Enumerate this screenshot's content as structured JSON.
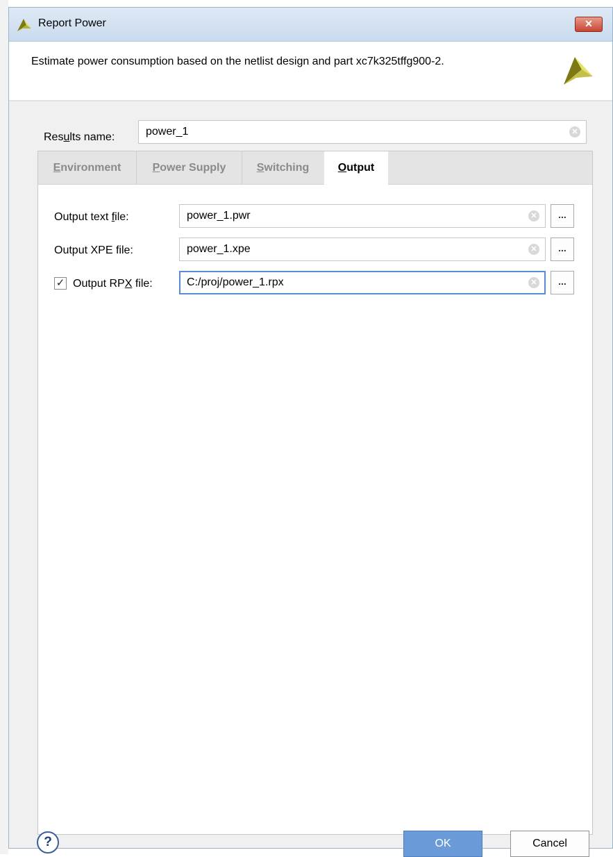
{
  "window": {
    "title": "Report Power",
    "close_label": "✕"
  },
  "header": {
    "description": "Estimate power consumption based on the netlist design and part xc7k325tffg900-2."
  },
  "results": {
    "label_pre": "Res",
    "label_key": "u",
    "label_post": "lts name:",
    "value": "power_1"
  },
  "tabs": [
    {
      "pre": "",
      "key": "E",
      "post": "nvironment"
    },
    {
      "pre": "",
      "key": "P",
      "post": "ower Supply"
    },
    {
      "pre": "",
      "key": "S",
      "post": "witching"
    },
    {
      "pre": "",
      "key": "O",
      "post": "utput"
    }
  ],
  "output": {
    "text_file": {
      "label_pre": "Output text ",
      "label_key": "f",
      "label_post": "ile:",
      "value": "power_1.pwr"
    },
    "xpe_file": {
      "label": "Output XPE file:",
      "value": "power_1.xpe"
    },
    "rpx_file": {
      "label_pre": "Output RP",
      "label_key": "X",
      "label_post": " file:",
      "value": "C:/proj/power_1.rpx",
      "checked": true,
      "check_glyph": "✓"
    },
    "browse_label": "..."
  },
  "footer": {
    "help_label": "?",
    "ok_label": "OK",
    "cancel_label": "Cancel"
  },
  "colors": {
    "accent": "#6b9ad8",
    "close": "#c74634",
    "focus_border": "#5b8ad6",
    "logo_dark": "#7d7a15",
    "logo_light": "#e3e26a"
  },
  "icons": {
    "app": "xilinx-logo-icon",
    "clear": "clear-circle-icon",
    "help": "help-icon"
  }
}
